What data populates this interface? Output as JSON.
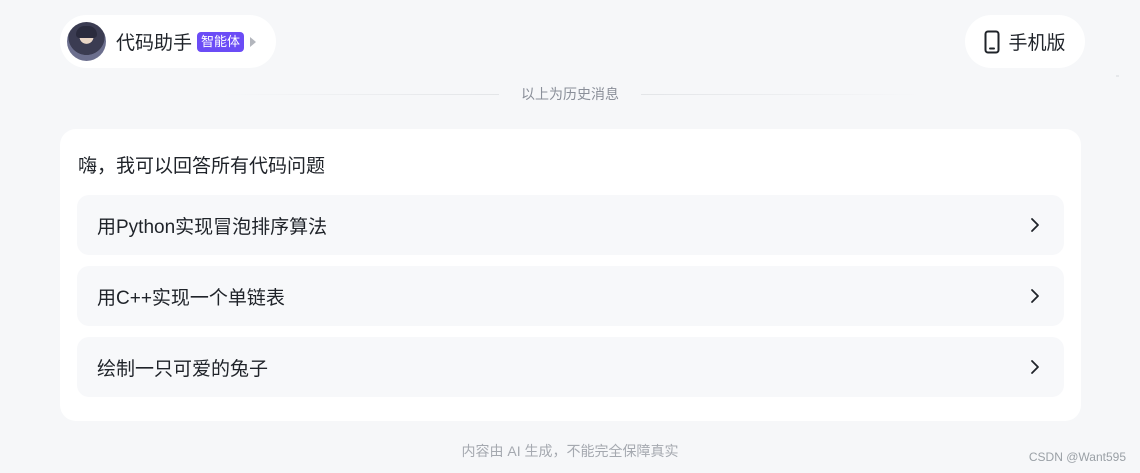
{
  "agent": {
    "name": "代码助手",
    "badge": "智能体"
  },
  "mobile_button": {
    "label": "手机版",
    "icon": "phone-icon"
  },
  "history_divider": "以上为历史消息",
  "greeting": "嗨，我可以回答所有代码问题",
  "suggestions": [
    {
      "label": "用Python实现冒泡排序算法"
    },
    {
      "label": "用C++实现一个单链表"
    },
    {
      "label": "绘制一只可爱的兔子"
    }
  ],
  "disclaimer": "内容由 AI 生成，不能完全保障真实",
  "watermark": "CSDN @Want595",
  "colors": {
    "background": "#f6f7f9",
    "badge": "#6b4cf6",
    "card": "#ffffff",
    "suggestion_bg": "#f7f8fa"
  }
}
